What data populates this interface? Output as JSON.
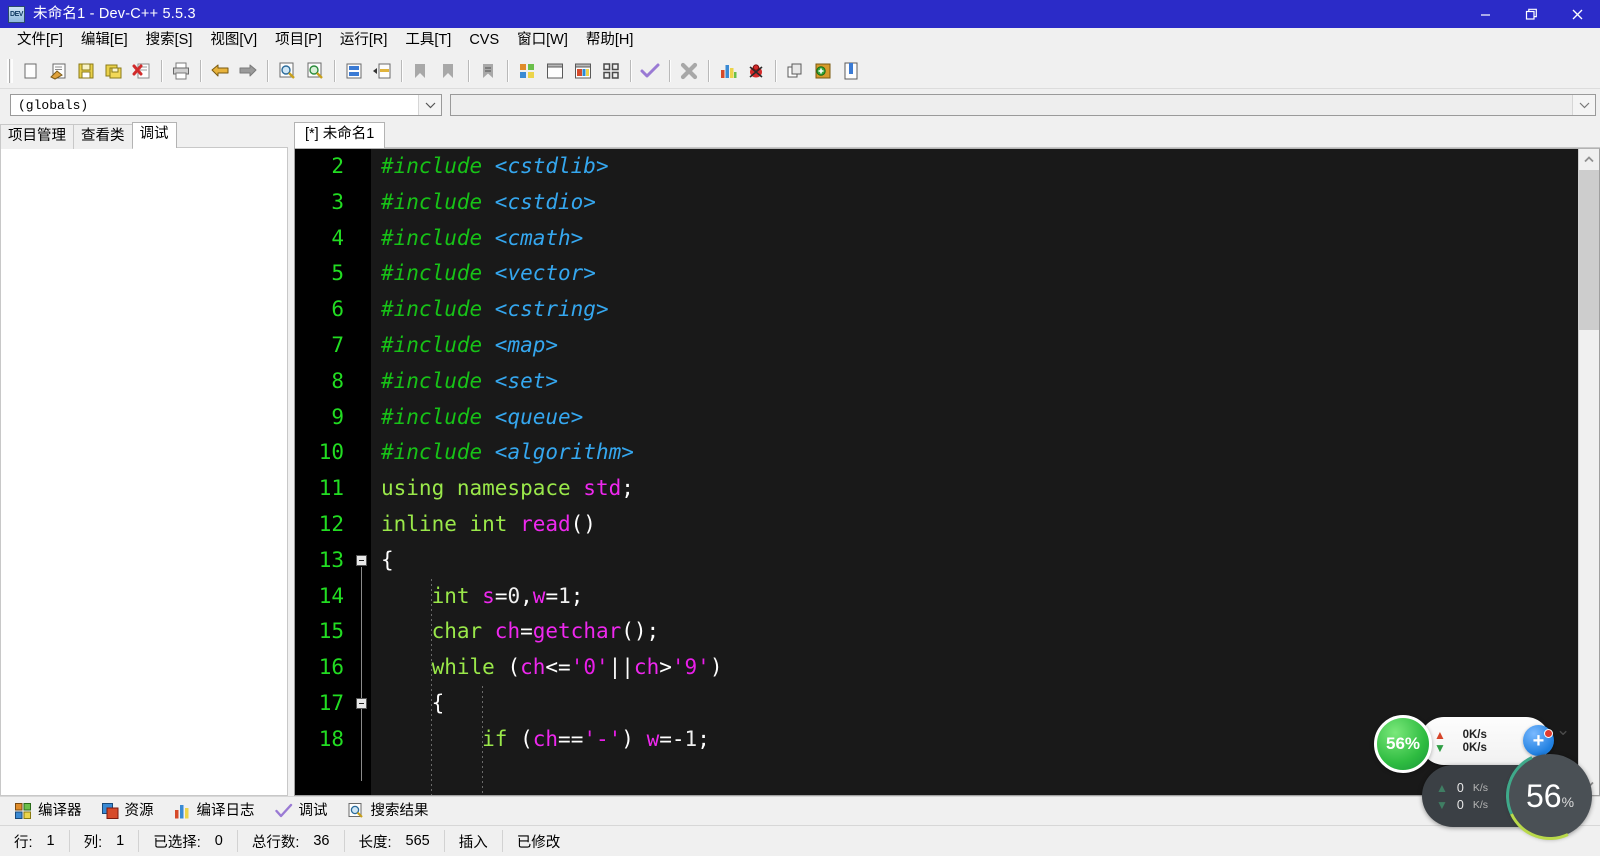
{
  "window": {
    "title": "未命名1 - Dev-C++ 5.5.3",
    "app_icon": "dev-cpp-icon",
    "minimize": "—",
    "restore": "❐",
    "close": "✕"
  },
  "menubar": {
    "items": [
      {
        "label": "文件[F]"
      },
      {
        "label": "编辑[E]"
      },
      {
        "label": "搜索[S]"
      },
      {
        "label": "视图[V]"
      },
      {
        "label": "项目[P]"
      },
      {
        "label": "运行[R]"
      },
      {
        "label": "工具[T]"
      },
      {
        "label": "CVS"
      },
      {
        "label": "窗口[W]"
      },
      {
        "label": "帮助[H]"
      }
    ]
  },
  "toolbar": {
    "groups": [
      [
        "new-file-icon",
        "open-file-icon",
        "save-icon",
        "save-all-icon",
        "close-file-icon",
        "print-icon"
      ],
      [
        "undo-icon",
        "redo-icon"
      ],
      [
        "find-icon",
        "replace-icon",
        "goto-line-icon",
        "goto-function-icon"
      ],
      [
        "compile-icon",
        "run-icon",
        "compile-run-icon"
      ],
      [
        "project-options-icon",
        "new-project-icon",
        "environment-options-icon",
        "grid-icon"
      ],
      [
        "check-syntax-icon",
        "stop-icon"
      ],
      [
        "profile-icon",
        "debug-icon"
      ],
      [
        "insert-icon",
        "toggle-icon",
        "goto-icon"
      ]
    ]
  },
  "combos": {
    "scope": {
      "value": "(globals)",
      "placeholder": ""
    },
    "symbol": {
      "value": "",
      "placeholder": ""
    },
    "arrow_icon": "chevron-down-icon"
  },
  "left_panel": {
    "tabs": [
      {
        "label": "项目管理",
        "active": false
      },
      {
        "label": "查看类",
        "active": false
      },
      {
        "label": "调试",
        "active": true
      }
    ],
    "content": ""
  },
  "editor_tabs": [
    {
      "label": "[*] 未命名1",
      "active": true
    }
  ],
  "editor": {
    "first_visible_line": 2,
    "fold_markers": [
      13,
      17
    ],
    "lines": [
      {
        "n": 2,
        "tokens": [
          {
            "t": "#include ",
            "c": "c-pre"
          },
          {
            "t": "<cstdlib>",
            "c": "c-hdr"
          }
        ]
      },
      {
        "n": 3,
        "tokens": [
          {
            "t": "#include ",
            "c": "c-pre"
          },
          {
            "t": "<cstdio>",
            "c": "c-hdr"
          }
        ]
      },
      {
        "n": 4,
        "tokens": [
          {
            "t": "#include ",
            "c": "c-pre"
          },
          {
            "t": "<cmath>",
            "c": "c-hdr"
          }
        ]
      },
      {
        "n": 5,
        "tokens": [
          {
            "t": "#include ",
            "c": "c-pre"
          },
          {
            "t": "<vector>",
            "c": "c-hdr"
          }
        ]
      },
      {
        "n": 6,
        "tokens": [
          {
            "t": "#include ",
            "c": "c-pre"
          },
          {
            "t": "<cstring>",
            "c": "c-hdr"
          }
        ]
      },
      {
        "n": 7,
        "tokens": [
          {
            "t": "#include ",
            "c": "c-pre"
          },
          {
            "t": "<map>",
            "c": "c-hdr"
          }
        ]
      },
      {
        "n": 8,
        "tokens": [
          {
            "t": "#include ",
            "c": "c-pre"
          },
          {
            "t": "<set>",
            "c": "c-hdr"
          }
        ]
      },
      {
        "n": 9,
        "tokens": [
          {
            "t": "#include ",
            "c": "c-pre"
          },
          {
            "t": "<queue>",
            "c": "c-hdr"
          }
        ]
      },
      {
        "n": 10,
        "tokens": [
          {
            "t": "#include ",
            "c": "c-pre"
          },
          {
            "t": "<algorithm>",
            "c": "c-hdr"
          }
        ]
      },
      {
        "n": 11,
        "tokens": [
          {
            "t": "using namespace ",
            "c": "c-kw"
          },
          {
            "t": "std",
            "c": "c-id"
          },
          {
            "t": ";",
            "c": "c-op"
          }
        ]
      },
      {
        "n": 12,
        "tokens": [
          {
            "t": "inline int ",
            "c": "c-kw"
          },
          {
            "t": "read",
            "c": "c-id"
          },
          {
            "t": "()",
            "c": "c-op"
          }
        ]
      },
      {
        "n": 13,
        "tokens": [
          {
            "t": "{",
            "c": "c-op"
          }
        ]
      },
      {
        "n": 14,
        "tokens": [
          {
            "t": "    ",
            "c": "c-plain"
          },
          {
            "t": "int ",
            "c": "c-kw"
          },
          {
            "t": "s",
            "c": "c-id"
          },
          {
            "t": "=",
            "c": "c-op"
          },
          {
            "t": "0",
            "c": "c-num"
          },
          {
            "t": ",",
            "c": "c-op"
          },
          {
            "t": "w",
            "c": "c-id"
          },
          {
            "t": "=",
            "c": "c-op"
          },
          {
            "t": "1",
            "c": "c-num"
          },
          {
            "t": ";",
            "c": "c-op"
          }
        ]
      },
      {
        "n": 15,
        "tokens": [
          {
            "t": "    ",
            "c": "c-plain"
          },
          {
            "t": "char ",
            "c": "c-kw"
          },
          {
            "t": "ch",
            "c": "c-id"
          },
          {
            "t": "=",
            "c": "c-op"
          },
          {
            "t": "getchar",
            "c": "c-id"
          },
          {
            "t": "();",
            "c": "c-op"
          }
        ]
      },
      {
        "n": 16,
        "tokens": [
          {
            "t": "    ",
            "c": "c-plain"
          },
          {
            "t": "while ",
            "c": "c-kw"
          },
          {
            "t": "(",
            "c": "c-op"
          },
          {
            "t": "ch",
            "c": "c-id"
          },
          {
            "t": "<=",
            "c": "c-op"
          },
          {
            "t": "'0'",
            "c": "c-str"
          },
          {
            "t": "||",
            "c": "c-op"
          },
          {
            "t": "ch",
            "c": "c-id"
          },
          {
            "t": ">",
            "c": "c-op"
          },
          {
            "t": "'9'",
            "c": "c-str"
          },
          {
            "t": ")",
            "c": "c-op"
          }
        ]
      },
      {
        "n": 17,
        "tokens": [
          {
            "t": "    ",
            "c": "c-plain"
          },
          {
            "t": "{",
            "c": "c-op"
          }
        ]
      },
      {
        "n": 18,
        "tokens": [
          {
            "t": "        ",
            "c": "c-plain"
          },
          {
            "t": "if ",
            "c": "c-kw"
          },
          {
            "t": "(",
            "c": "c-op"
          },
          {
            "t": "ch",
            "c": "c-id"
          },
          {
            "t": "==",
            "c": "c-op"
          },
          {
            "t": "'-'",
            "c": "c-str"
          },
          {
            "t": ") ",
            "c": "c-op"
          },
          {
            "t": "w",
            "c": "c-id"
          },
          {
            "t": "=-",
            "c": "c-op"
          },
          {
            "t": "1",
            "c": "c-num"
          },
          {
            "t": ";",
            "c": "c-op"
          }
        ]
      }
    ]
  },
  "scrollbar": {
    "up_icon": "chevron-up-icon",
    "down_icon": "chevron-down-icon"
  },
  "bottom_tabs": [
    {
      "label": "编译器",
      "icon": "compiler-icon"
    },
    {
      "label": "资源",
      "icon": "resources-icon"
    },
    {
      "label": "编译日志",
      "icon": "compile-log-icon"
    },
    {
      "label": "调试",
      "icon": "debug-check-icon"
    },
    {
      "label": "搜索结果",
      "icon": "search-results-icon"
    }
  ],
  "statusbar": {
    "row_label": "行:",
    "row_value": "1",
    "col_label": "列:",
    "col_value": "1",
    "sel_label": "已选择:",
    "sel_value": "0",
    "total_label": "总行数:",
    "total_value": "36",
    "len_label": "长度:",
    "len_value": "565",
    "insert_mode": "插入",
    "modified": "已修改"
  },
  "float_widgets": {
    "light": {
      "percent": "56%",
      "up_rate": "0K/s",
      "down_rate": "0K/s",
      "plus_icon": "plus-icon",
      "up_icon": "arrow-up-icon",
      "down_icon": "arrow-down-icon"
    },
    "dark": {
      "up_rate": "0",
      "up_unit": "K/s",
      "down_rate": "0",
      "down_unit": "K/s",
      "up_icon": "arrow-up-icon",
      "down_icon": "arrow-down-icon"
    },
    "gauge": {
      "value": "56",
      "unit": "%"
    }
  },
  "colors": {
    "titlebar": "#2b2bc8",
    "editor_bg": "#191919",
    "gutter_bg": "#000000",
    "line_number": "#22dd22",
    "preproc": "#17c217",
    "header": "#35a7ef",
    "keyword": "#9ae84a",
    "identifier": "#ee28ee",
    "string": "#e91ee9",
    "chrome": "#f0f0f0"
  }
}
